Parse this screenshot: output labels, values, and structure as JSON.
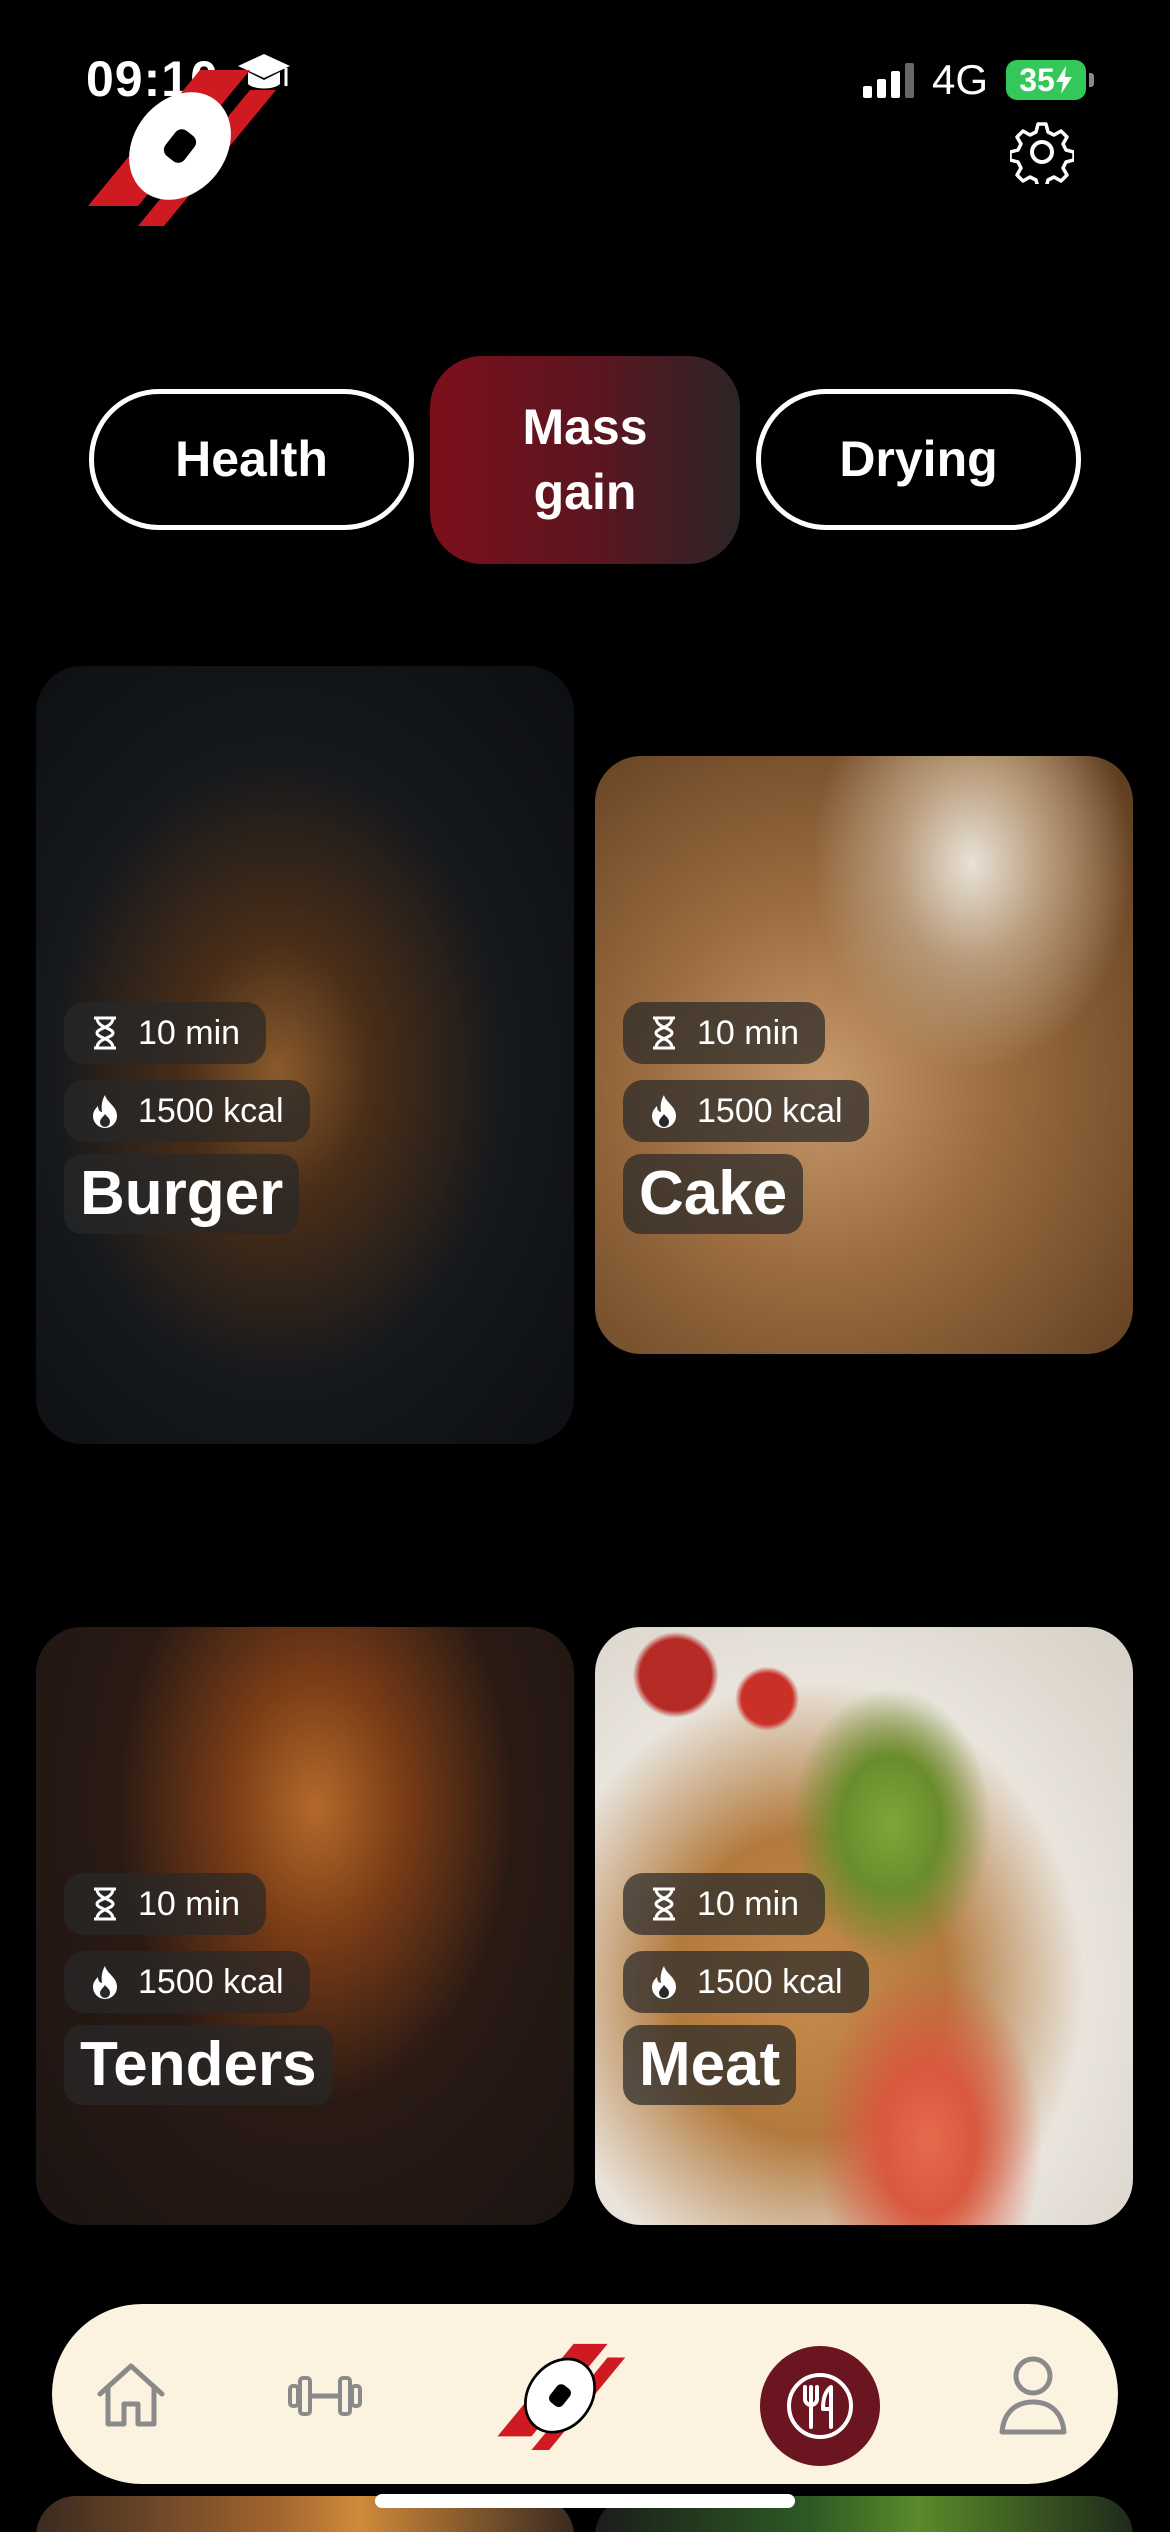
{
  "status_bar": {
    "time": "09:10",
    "network": "4G",
    "battery": "35"
  },
  "tabs": [
    {
      "label": "Health",
      "active": false
    },
    {
      "label": "Mass gain",
      "active": true
    },
    {
      "label": "Drying",
      "active": false
    }
  ],
  "recipes": [
    {
      "title": "Burger",
      "time": "10 min",
      "calories": "1500 kcal"
    },
    {
      "title": "Cake",
      "time": "10 min",
      "calories": "1500 kcal"
    },
    {
      "title": "Tenders",
      "time": "10 min",
      "calories": "1500 kcal"
    },
    {
      "title": "Meat",
      "time": "10 min",
      "calories": "1500 kcal"
    }
  ],
  "nav": {
    "items": [
      "home-icon",
      "dumbbell-icon",
      "logo-icon",
      "fork-knife-icon",
      "profile-icon"
    ],
    "active": "fork-knife-icon"
  },
  "colors": {
    "accent": "#7c0f1b",
    "logo_red": "#d01a22",
    "nav_bg": "#fbf2df",
    "battery": "#34c759"
  }
}
